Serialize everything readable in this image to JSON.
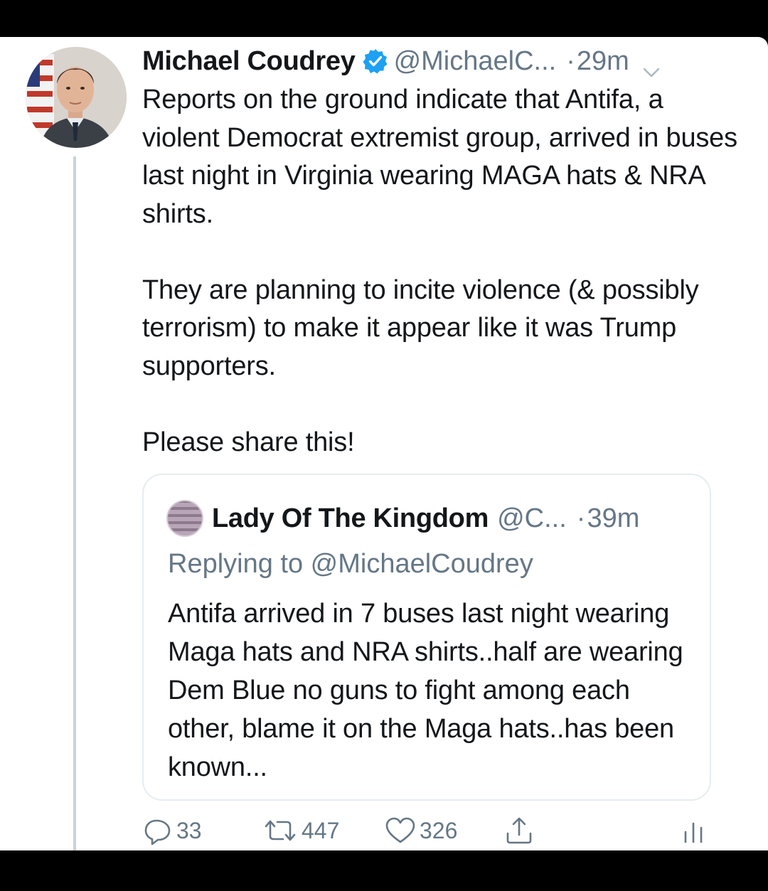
{
  "tweet": {
    "author_name": "Michael Coudrey",
    "handle": "@MichaelC...",
    "time_dot": "·",
    "time": "29m",
    "paragraphs": [
      "Reports on the ground indicate that Antifa, a violent Democrat extremist group, arrived in buses last night in Virginia wearing MAGA hats & NRA shirts.",
      "They are planning to incite violence (& possibly terrorism) to make it appear like it was Trump supporters.",
      "Please share this!"
    ],
    "verified": true,
    "icons": {
      "verified": "verified-badge-icon",
      "menu": "chevron-down-icon"
    },
    "colors": {
      "text": "#14171a",
      "muted": "#657786",
      "verified": "#1da1f2",
      "thread_line": "#c9d2d9"
    }
  },
  "quoted_tweet": {
    "author_name": "Lady Of The Kingdom",
    "handle": "@C...",
    "time_dot": "·",
    "time": "39m",
    "replying_to": "Replying to @MichaelCoudrey",
    "text": "Antifa arrived in 7 buses last night wearing Maga hats and NRA shirts..half are wearing Dem Blue no guns to fight among each other, blame it on the Maga hats..has been known..."
  },
  "actions": {
    "reply_count": "33",
    "retweet_count": "447",
    "like_count": "326",
    "icons": [
      "reply-icon",
      "retweet-icon",
      "like-icon",
      "share-icon",
      "analytics-icon"
    ]
  }
}
